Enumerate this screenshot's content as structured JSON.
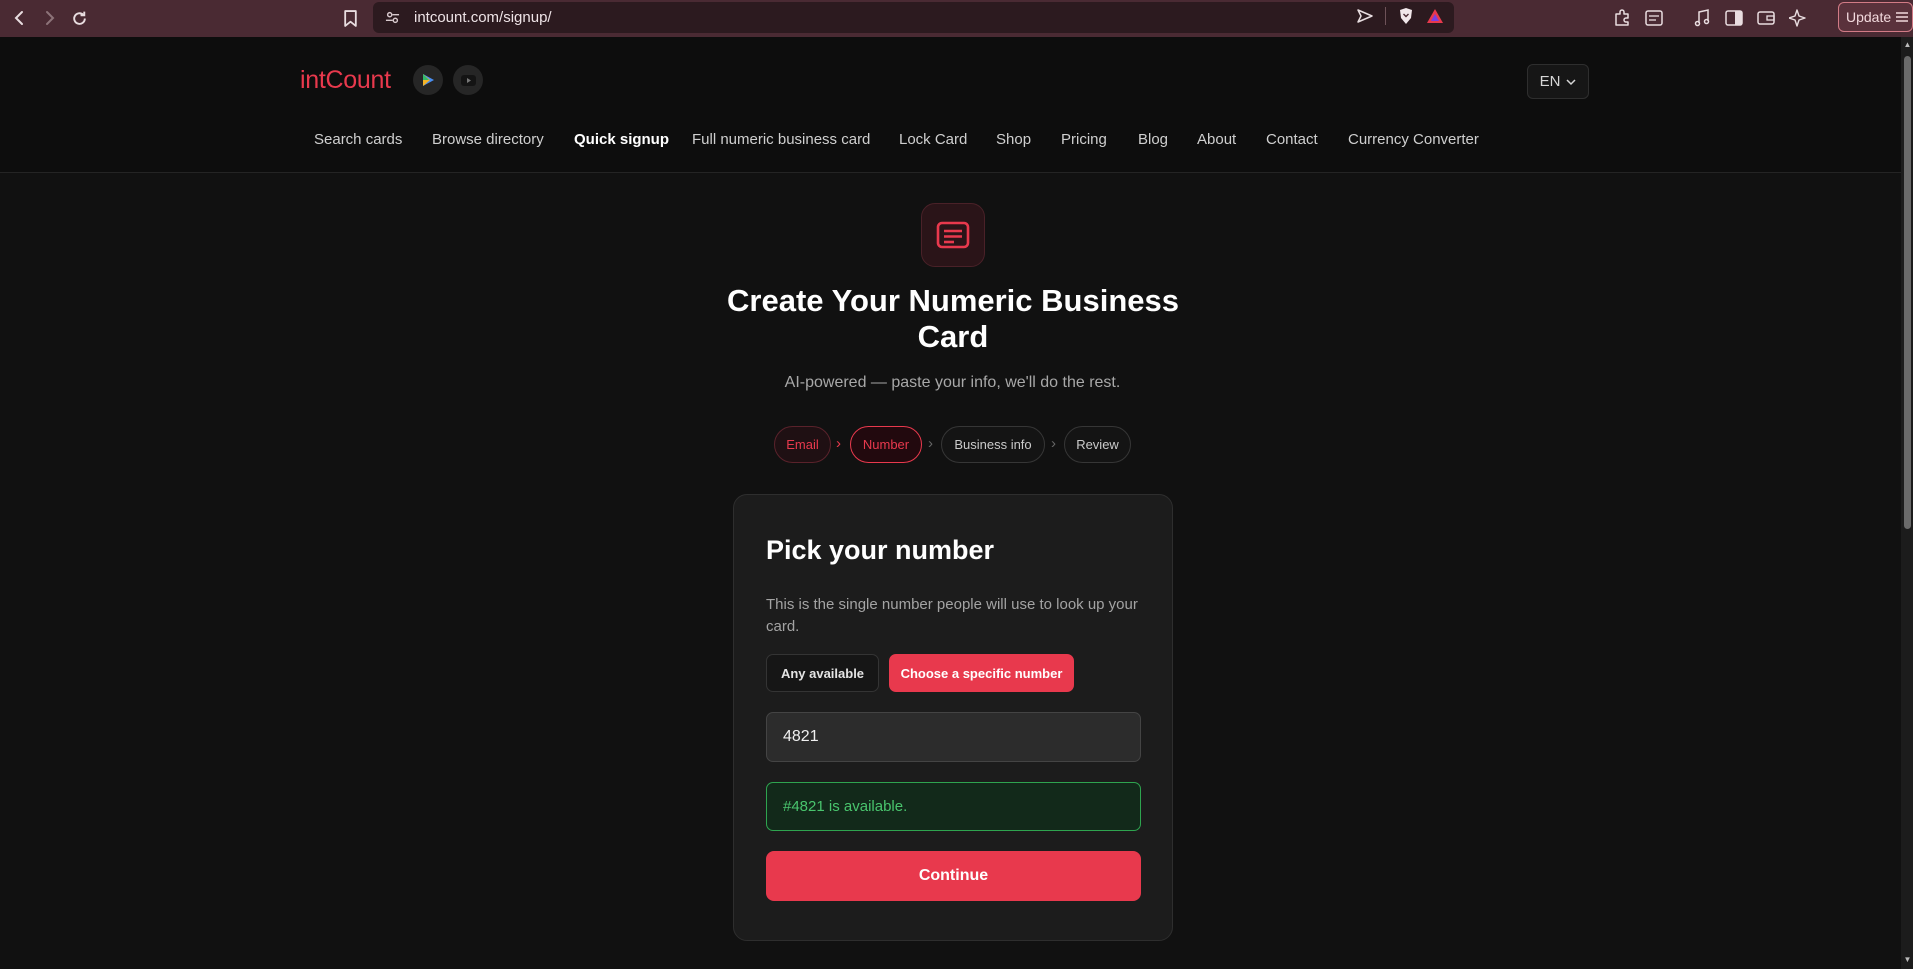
{
  "browser": {
    "url": "intcount.com/signup/",
    "update_label": "Update"
  },
  "header": {
    "logo": "intCount",
    "language": "EN",
    "nav": [
      {
        "label": "Search cards",
        "active": false
      },
      {
        "label": "Browse directory",
        "active": false
      },
      {
        "label": "Quick signup",
        "active": true
      },
      {
        "label": "Full numeric business card",
        "active": false
      },
      {
        "label": "Lock Card",
        "active": false
      },
      {
        "label": "Shop",
        "active": false
      },
      {
        "label": "Pricing",
        "active": false
      },
      {
        "label": "Blog",
        "active": false
      },
      {
        "label": "About",
        "active": false
      },
      {
        "label": "Contact",
        "active": false
      },
      {
        "label": "Currency Converter",
        "active": false
      }
    ]
  },
  "hero": {
    "title": "Create Your Numeric Business Card",
    "subtitle": "AI-powered — paste your info, we'll do the rest."
  },
  "stepper": {
    "steps": [
      {
        "label": "Email",
        "state": "done"
      },
      {
        "label": "Number",
        "state": "current"
      },
      {
        "label": "Business info",
        "state": "upcoming"
      },
      {
        "label": "Review",
        "state": "upcoming"
      }
    ],
    "separator": "›"
  },
  "card": {
    "title": "Pick your number",
    "description": "This is the single number people will use to look up your card.",
    "option_any": "Any available",
    "option_specific": "Choose a specific number",
    "selected_option": "Choose a specific number",
    "number_value": "4821",
    "availability_message": "#4821 is available.",
    "continue_label": "Continue"
  },
  "colors": {
    "accent": "#e8394d",
    "success": "#49c46d",
    "background": "#0f0f0f",
    "chrome": "#4a2a33"
  },
  "icons": {
    "header_play": "play-store-icon",
    "header_youtube": "youtube-icon",
    "hero": "card-icon"
  }
}
